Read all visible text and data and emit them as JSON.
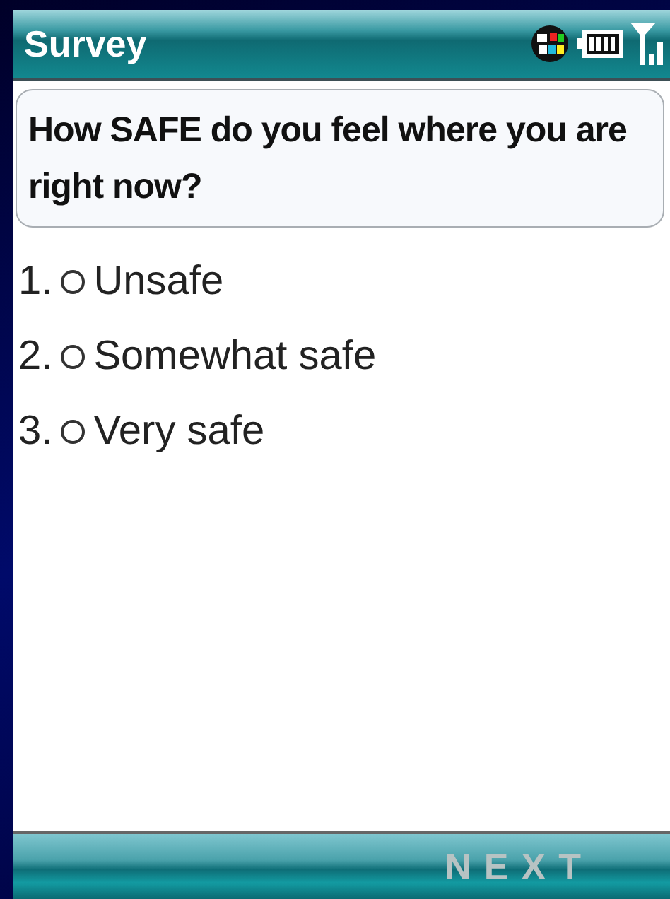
{
  "title_bar": {
    "title": "Survey"
  },
  "question": "How SAFE do you feel where you are right now?",
  "options": [
    {
      "number": "1.",
      "label": "Unsafe",
      "selected": false
    },
    {
      "number": "2.",
      "label": "Somewhat safe",
      "selected": false
    },
    {
      "number": "3.",
      "label": "Very safe",
      "selected": false
    }
  ],
  "softkey": {
    "label": "NEXT",
    "disabled": true
  }
}
